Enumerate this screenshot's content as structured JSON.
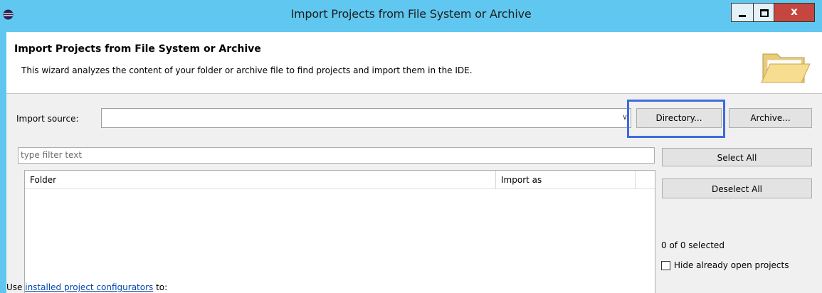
{
  "window": {
    "title": "Import Projects from File System or Archive",
    "controls": {
      "minimize": "minimize",
      "maximize": "maximize",
      "close": "x"
    }
  },
  "header": {
    "title": "Import Projects from File System or Archive",
    "description": "This wizard analyzes the content of your folder or archive file to find projects and import them in the IDE."
  },
  "import_source": {
    "label": "Import source:",
    "value": ""
  },
  "buttons": {
    "directory": "Directory...",
    "archive": "Archive...",
    "select_all": "Select All",
    "deselect_all": "Deselect All"
  },
  "filter": {
    "placeholder": "type filter text"
  },
  "table": {
    "columns": [
      "Folder",
      "Import as"
    ],
    "rows": []
  },
  "selection_count": "0 of 0 selected",
  "hide_open": {
    "label": "Hide already open projects",
    "checked": false
  },
  "bottom": {
    "prefix": "Use ",
    "link": "installed project configurators",
    "suffix": " to:"
  },
  "colors": {
    "titlebar": "#60c8f0",
    "close": "#c5463f",
    "highlight": "#3d6be0",
    "link": "#0645ad"
  }
}
